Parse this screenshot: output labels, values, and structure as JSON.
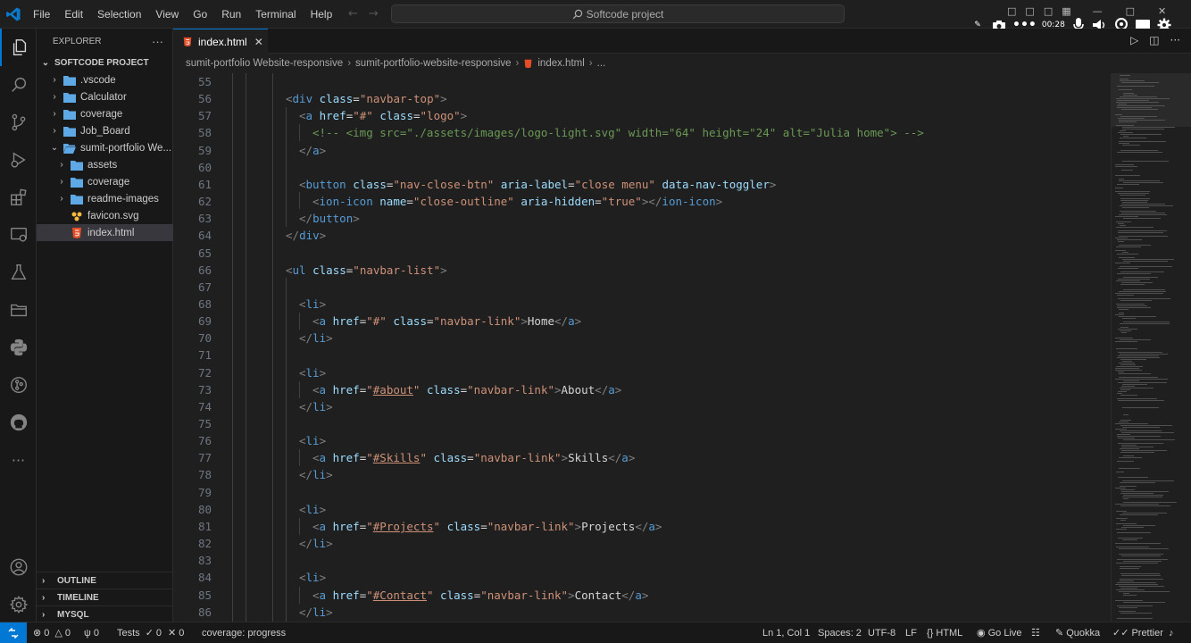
{
  "menu": [
    "File",
    "Edit",
    "Selection",
    "View",
    "Go",
    "Run",
    "Terminal",
    "Help"
  ],
  "command_center": {
    "label": "Softcode project"
  },
  "recorder": {
    "time": "00:28"
  },
  "sidebar": {
    "title": "EXPLORER",
    "project": "SOFTCODE PROJECT",
    "items": [
      {
        "label": ".vscode",
        "kind": "folder"
      },
      {
        "label": "Calculator",
        "kind": "folder"
      },
      {
        "label": "coverage",
        "kind": "folder"
      },
      {
        "label": "Job_Board",
        "kind": "folder"
      },
      {
        "label": "sumit-portfolio We...",
        "kind": "folder-open"
      },
      {
        "label": "assets",
        "kind": "folder"
      },
      {
        "label": "coverage",
        "kind": "folder"
      },
      {
        "label": "readme-images",
        "kind": "folder"
      },
      {
        "label": "favicon.svg",
        "kind": "svg-file"
      },
      {
        "label": "index.html",
        "kind": "html-file"
      }
    ],
    "sections": [
      "OUTLINE",
      "TIMELINE",
      "MYSQL"
    ]
  },
  "tab": {
    "label": "index.html"
  },
  "breadcrumb": [
    "sumit-portfolio Website-responsive",
    "sumit-portfolio-website-responsive",
    "index.html",
    "..."
  ],
  "code_lines": [
    {
      "n": "55",
      "text": ""
    },
    {
      "n": "56",
      "text": "<div class=\"navbar-top\">"
    },
    {
      "n": "57",
      "text": "<a href=\"#\" class=\"logo\">"
    },
    {
      "n": "58",
      "text": "<!-- <img src=\"./assets/images/logo-light.svg\" width=\"64\" height=\"24\" alt=\"Julia home\"> -->"
    },
    {
      "n": "59",
      "text": "</a>"
    },
    {
      "n": "60",
      "text": ""
    },
    {
      "n": "61",
      "text": "<button class=\"nav-close-btn\" aria-label=\"close menu\" data-nav-toggler>"
    },
    {
      "n": "62",
      "text": "<ion-icon name=\"close-outline\" aria-hidden=\"true\"></ion-icon>"
    },
    {
      "n": "63",
      "text": "</button>"
    },
    {
      "n": "64",
      "text": "</div>"
    },
    {
      "n": "65",
      "text": ""
    },
    {
      "n": "66",
      "text": "<ul class=\"navbar-list\">"
    },
    {
      "n": "67",
      "text": ""
    },
    {
      "n": "68",
      "text": "<li>"
    },
    {
      "n": "69",
      "text": "<a href=\"#\" class=\"navbar-link\">Home</a>"
    },
    {
      "n": "70",
      "text": "</li>"
    },
    {
      "n": "71",
      "text": ""
    },
    {
      "n": "72",
      "text": "<li>"
    },
    {
      "n": "73",
      "text": "<a href=\"#about\" class=\"navbar-link\">About</a>"
    },
    {
      "n": "74",
      "text": "</li>"
    },
    {
      "n": "75",
      "text": ""
    },
    {
      "n": "76",
      "text": "<li>"
    },
    {
      "n": "77",
      "text": "<a href=\"#Skills\" class=\"navbar-link\">Skills</a>"
    },
    {
      "n": "78",
      "text": "</li>"
    },
    {
      "n": "79",
      "text": ""
    },
    {
      "n": "80",
      "text": "<li>"
    },
    {
      "n": "81",
      "text": "<a href=\"#Projects\" class=\"navbar-link\">Projects</a>"
    },
    {
      "n": "82",
      "text": "</li>"
    },
    {
      "n": "83",
      "text": ""
    },
    {
      "n": "84",
      "text": "<li>"
    },
    {
      "n": "85",
      "text": "<a href=\"#Contact\" class=\"navbar-link\">Contact</a>"
    },
    {
      "n": "86",
      "text": "</li>"
    }
  ],
  "status": {
    "errors": "0",
    "warnings": "0",
    "ports": "0",
    "tests_label": "Tests",
    "tests_passed": "0",
    "tests_failed": "0",
    "coverage": "coverage: progress",
    "position": "Ln 1, Col 1",
    "spaces": "Spaces: 2",
    "encoding": "UTF-8",
    "eol": "LF",
    "language": "HTML",
    "golive": "Go Live",
    "quokka": "Quokka",
    "prettier": "Prettier"
  },
  "colors": {
    "accent": "#0078d4",
    "tag": "#569cd6",
    "attr": "#9cdcfe",
    "string": "#ce9178",
    "comment": "#6a9955"
  }
}
